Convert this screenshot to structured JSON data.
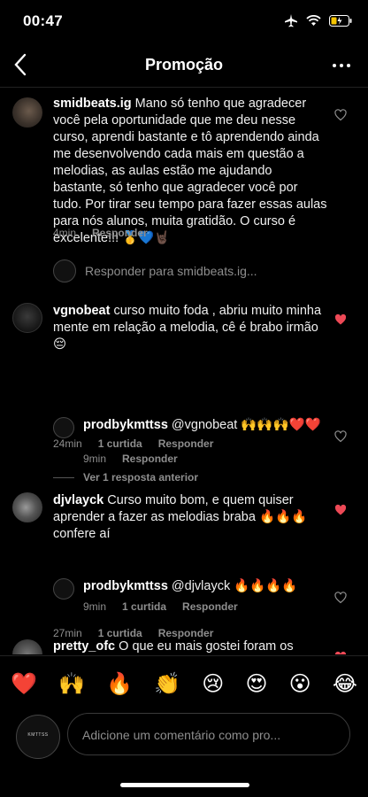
{
  "status": {
    "time": "00:47"
  },
  "nav": {
    "title": "Promoção"
  },
  "comments": [
    {
      "user": "smidbeats.ig",
      "text": "Mano só tenho que agradecer você pela oportunidade que me deu nesse curso, aprendi bastante e tô aprendendo ainda me desenvolvendo cada mais em questão a melodias, as aulas estão me ajudando bastante, só tenho que agradecer você por tudo. Por tirar seu tempo para fazer essas aulas para nós alunos, muita gratidão. O curso é excelente!!! 🥇💙🤘🏿",
      "time": "4min",
      "reply": "Responder",
      "reply_to": "Responder para smidbeats.ig...",
      "liked": false
    },
    {
      "user": "vgnobeat",
      "text": "curso muito foda , abriu muito minha mente em relação a melodia, cê é brabo irmão 😔",
      "time": "24min",
      "likes": "1 curtida",
      "reply": "Responder",
      "view_previous": "Ver 1 resposta anterior",
      "liked": true
    },
    {
      "user": "prodbykmttss",
      "text": "@vgnobeat 🙌🙌🙌❤️❤️",
      "time": "9min",
      "reply": "Responder",
      "liked": false
    },
    {
      "user": "djvlayck",
      "text": "Curso muito bom, e quem quiser aprender a fazer as melodias braba 🔥🔥🔥 confere aí",
      "time": "27min",
      "likes": "1 curtida",
      "reply": "Responder",
      "liked": true
    },
    {
      "user": "prodbykmttss",
      "text": "@djvlayck 🔥🔥🔥🔥",
      "time": "9min",
      "likes": "1 curtida",
      "reply": "Responder",
      "liked": false
    },
    {
      "user": "pretty_ofc",
      "text": "O que eu mais gostei foram os",
      "liked": true
    }
  ],
  "emojis": [
    "❤️",
    "🙌",
    "🔥",
    "👏",
    "😢",
    "😍",
    "😮",
    "😂"
  ],
  "composer": {
    "placeholder": "Adicione um comentário como pro...",
    "avatar_text": "KMTTSS"
  },
  "colors": {
    "heart_liked": "#ed4956",
    "secondary_text": "#8e8e8e"
  }
}
